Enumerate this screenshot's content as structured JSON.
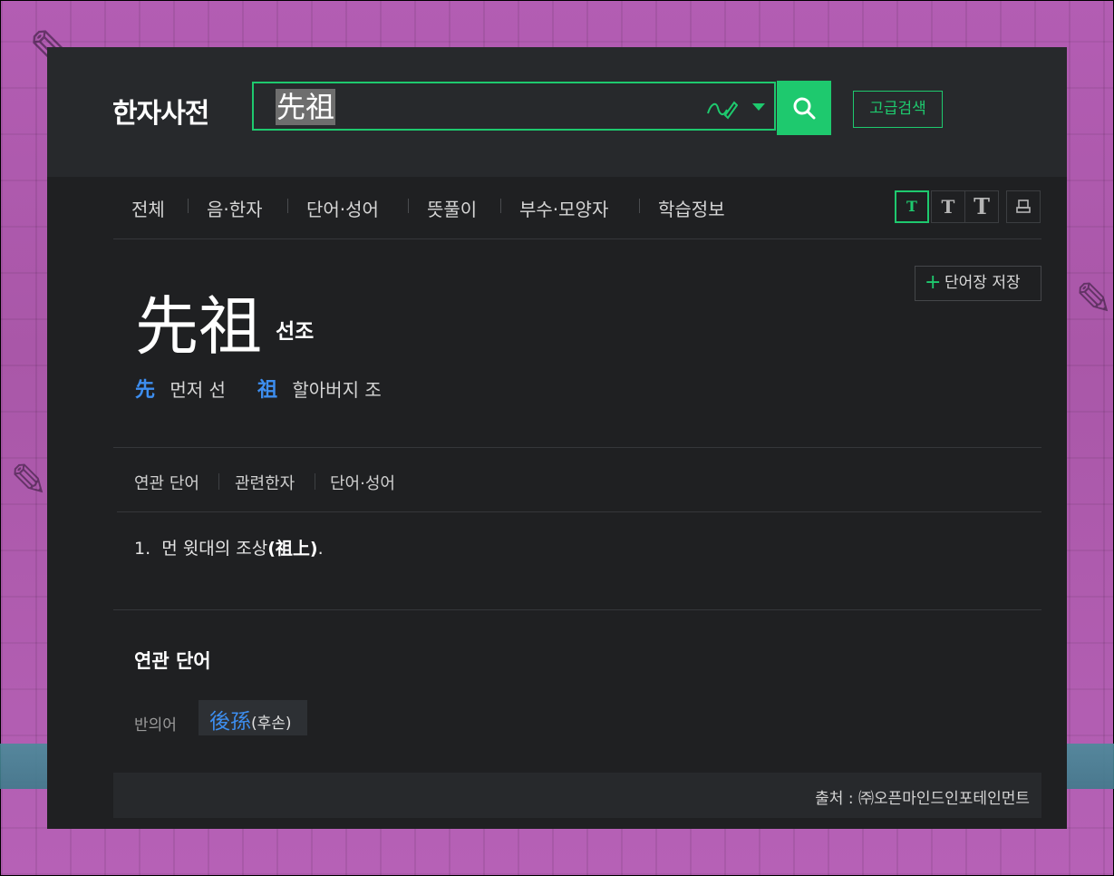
{
  "header": {
    "logo": "한자사전",
    "search_value": "先祖",
    "advanced_search_label": "고급검색"
  },
  "nav": {
    "items": [
      "전체",
      "음·한자",
      "단어·성어",
      "뜻풀이",
      "부수·모양자",
      "학습정보"
    ],
    "font_sizes": [
      "T",
      "T",
      "T"
    ]
  },
  "entry": {
    "save_label": "단어장 저장",
    "hanja": "先祖",
    "reading": "선조",
    "chars": [
      {
        "hanja": "先",
        "meaning": "먼저 선"
      },
      {
        "hanja": "祖",
        "meaning": "할아버지 조"
      }
    ],
    "tabs": [
      "연관 단어",
      "관련한자",
      "단어·성어"
    ],
    "definition": {
      "number": "1.",
      "text": "먼 윗대의 조상",
      "paren": "(祖上)",
      "end": "."
    },
    "related_section_title": "연관 단어",
    "related": {
      "label": "반의어",
      "hanja": "後孫",
      "reading": "(후손)"
    },
    "source": "출처 : ㈜오픈마인드인포테인먼트"
  },
  "colors": {
    "accent": "#1ec96e",
    "hanja_link": "#3d8ef0",
    "panel_bg": "#1f2022",
    "header_bg": "#27292c"
  }
}
